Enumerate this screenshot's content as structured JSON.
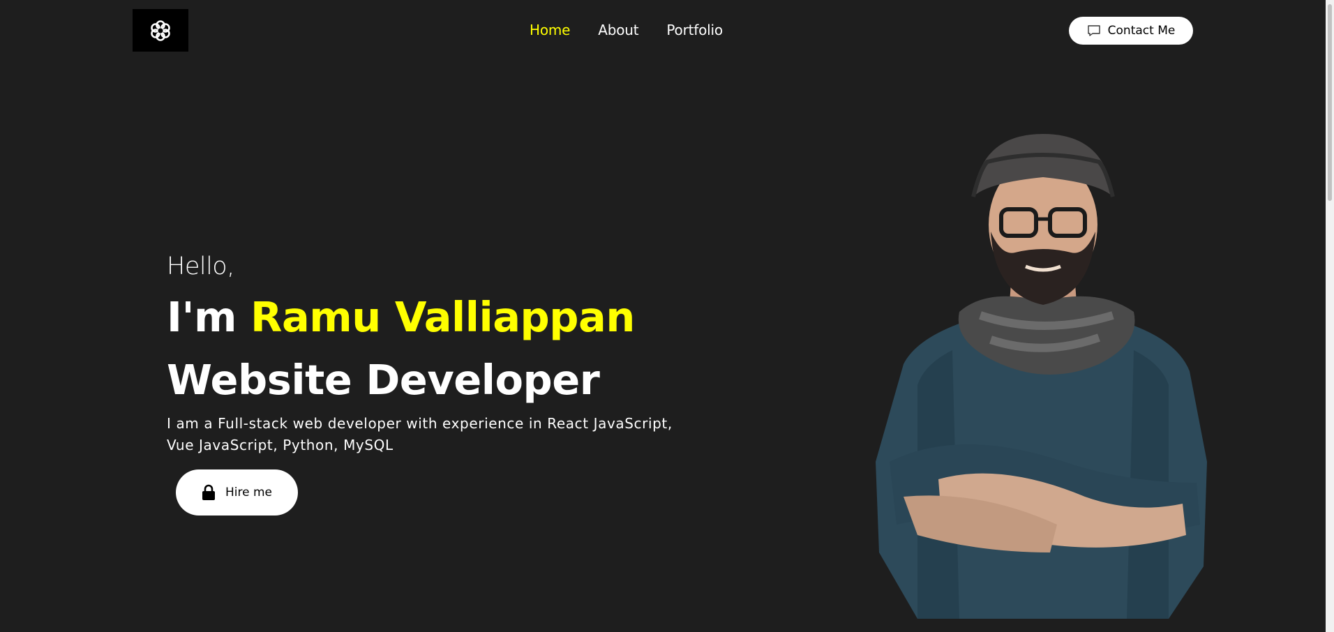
{
  "header": {
    "logo_icon": "flower-logo-icon",
    "nav": {
      "home": "Home",
      "about": "About",
      "portfolio": "Portfolio"
    },
    "contact_button": {
      "icon": "chat-bubble-icon",
      "label": "Contact Me"
    }
  },
  "hero": {
    "greeting": "Hello,",
    "intro_prefix": "I'm ",
    "name": "Ramu Valliappan",
    "role": "Website Developer",
    "description_line1": "I am a Full-stack web developer with experience in React JavaScript,",
    "description_line2": "Vue JavaScript, Python, MySQL",
    "hire_button": {
      "icon": "lock-icon",
      "label": "Hire me"
    }
  },
  "portrait": {
    "description": "developer-portrait-photo"
  },
  "colors": {
    "background": "#1e1e1e",
    "accent": "#ffff00",
    "text": "#ffffff",
    "button_bg": "#ffffff"
  }
}
